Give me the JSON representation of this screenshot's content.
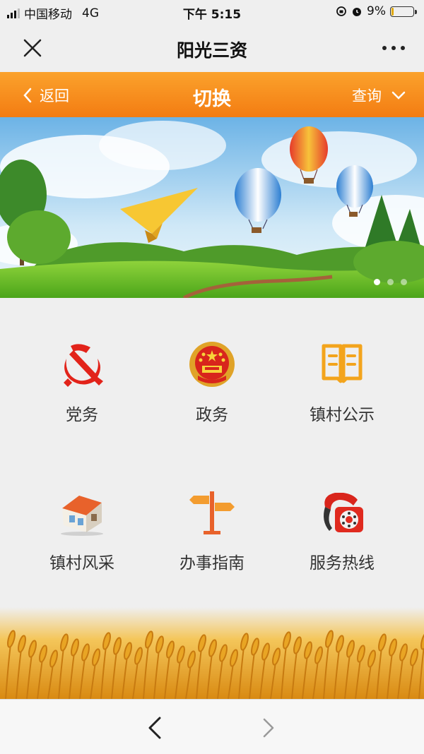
{
  "status_bar": {
    "carrier": "中国移动",
    "network": "4G",
    "time": "下午 5:15",
    "battery": "9%",
    "battery_level": 0.09
  },
  "nav": {
    "title": "阳光三资",
    "close_icon": "close-icon",
    "more_icon": "more-icon"
  },
  "header": {
    "back_label": "返回",
    "title": "切换",
    "query_label": "查询"
  },
  "banner": {
    "slides": 3,
    "active_slide": 1
  },
  "tiles": [
    {
      "label": "党务",
      "icon": "party-emblem-icon"
    },
    {
      "label": "政务",
      "icon": "national-emblem-icon"
    },
    {
      "label": "镇村公示",
      "icon": "book-icon"
    },
    {
      "label": "镇村风采",
      "icon": "house-icon"
    },
    {
      "label": "办事指南",
      "icon": "signpost-icon"
    },
    {
      "label": "服务热线",
      "icon": "telephone-icon"
    }
  ],
  "colors": {
    "orange_top": "#fba22c",
    "orange_bottom": "#f37c12",
    "party_red": "#e2231a"
  }
}
